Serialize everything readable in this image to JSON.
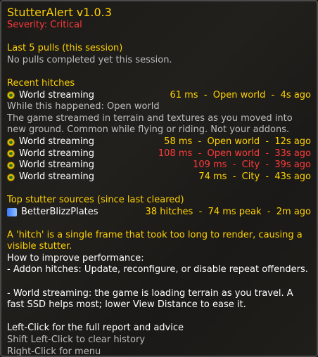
{
  "header": {
    "title": "StutterAlert v1.0.3",
    "severity": "Severity: Critical"
  },
  "last_pulls": {
    "heading": "Last 5 pulls (this session)",
    "message": "No pulls completed yet this session."
  },
  "recent_hitches": {
    "heading": "Recent hitches",
    "first": {
      "label": "World streaming",
      "stats": "61 ms  -  Open world  -  4s ago"
    },
    "context": "While this happened: Open world",
    "description": "The game streamed in terrain and textures as you moved into new ground. Common while flying or riding. Not your addons.",
    "rows": [
      {
        "label": "World streaming",
        "stats": "58 ms  -  Open world  -  12s ago",
        "color": "#ffd200"
      },
      {
        "label": "World streaming",
        "stats": "108 ms  -  Open world  -  33s ago",
        "color": "#ff3b3b"
      },
      {
        "label": "World streaming",
        "stats": "109 ms  -  City  -  39s ago",
        "color": "#ff3b3b"
      },
      {
        "label": "World streaming",
        "stats": "74 ms  -  City  -  43s ago",
        "color": "#ffd200"
      }
    ]
  },
  "top_sources": {
    "heading": "Top stutter sources (since last cleared)",
    "rows": [
      {
        "label": "BetterBlizzPlates",
        "stats": "38 hitches  -  74 ms peak  -  2m ago"
      }
    ]
  },
  "explanation": {
    "definition": "A 'hitch' is a single frame that took too long to render, causing a visible stutter.",
    "how_to": "How to improve performance:",
    "addon_tip": "- Addon hitches: Update, reconfigure, or disable repeat offenders.",
    "world_tip": "- World streaming: the game is loading terrain as you travel. A fast SSD helps most; lower View Distance to ease it."
  },
  "hints": {
    "left_click": "Left-Click for the full report and advice",
    "shift_left_click": "Shift Left-Click to clear history",
    "right_click": "Right-Click for menu"
  },
  "colors": {
    "gold": "#ffd200",
    "red": "#ff3b3b",
    "gray": "#bdbdbd"
  },
  "icons": {
    "world": "world-streaming-icon",
    "addon": "addon-icon"
  }
}
